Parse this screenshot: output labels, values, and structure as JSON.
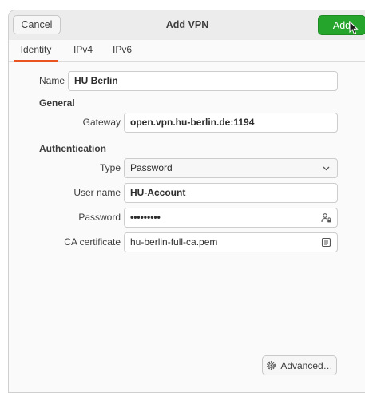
{
  "header": {
    "cancel_label": "Cancel",
    "title": "Add VPN",
    "add_label": "Add"
  },
  "tabs": [
    {
      "label": "Identity",
      "active": true
    },
    {
      "label": "IPv4",
      "active": false
    },
    {
      "label": "IPv6",
      "active": false
    }
  ],
  "identity": {
    "name_label": "Name",
    "name_value": "HU Berlin"
  },
  "general": {
    "heading": "General",
    "gateway_label": "Gateway",
    "gateway_value": "open.vpn.hu-berlin.de:1194"
  },
  "authentication": {
    "heading": "Authentication",
    "type_label": "Type",
    "type_value": "Password",
    "username_label": "User name",
    "username_value": "HU-Account",
    "password_label": "Password",
    "password_value": "•••••••••",
    "ca_label": "CA certificate",
    "ca_value": "hu-berlin-full-ca.pem"
  },
  "advanced_label": "Advanced…",
  "colors": {
    "accent": "#e95420",
    "add_button": "#26a52c"
  },
  "icons": {
    "type_dropdown": "chevron-down-icon",
    "password": "user-lock-icon",
    "ca_certificate": "file-chooser-icon",
    "advanced": "gear-icon",
    "cursor": "mouse-pointer-icon"
  }
}
